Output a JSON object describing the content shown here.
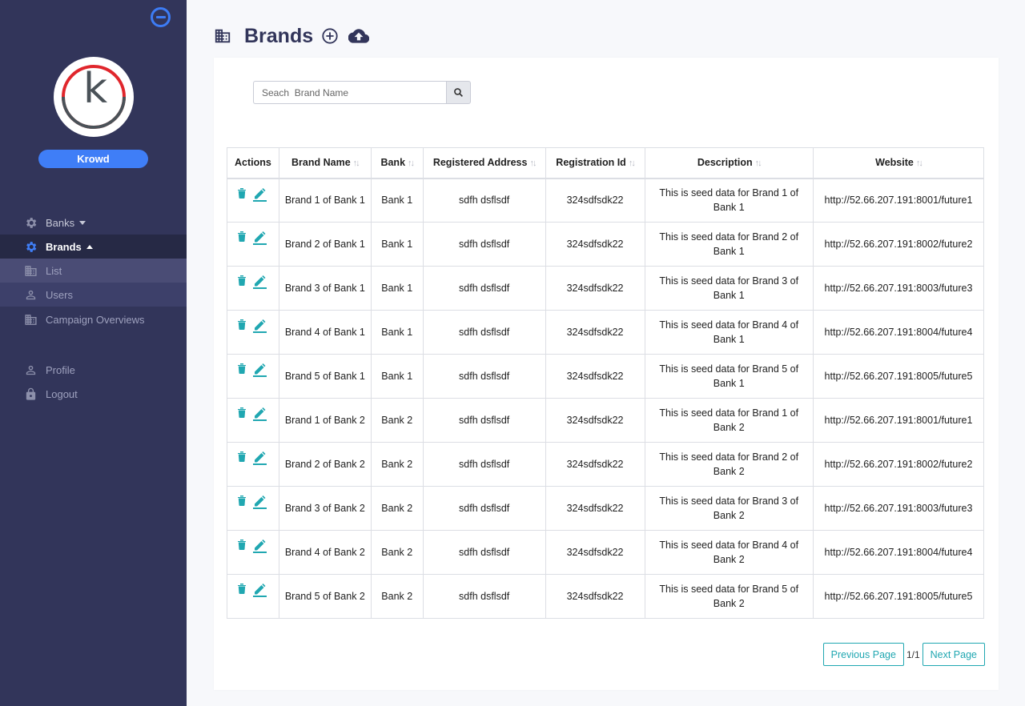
{
  "sidebar": {
    "user_name": "Krowd",
    "logo_letter": "k",
    "nav": [
      {
        "label": "Banks",
        "icon": "gear-icon"
      },
      {
        "label": "Brands",
        "icon": "gear-icon"
      },
      {
        "label": "List",
        "icon": "building-icon"
      },
      {
        "label": "Users",
        "icon": "user-icon"
      },
      {
        "label": "Campaign Overviews",
        "icon": "building-icon"
      },
      {
        "label": "Profile",
        "icon": "user-icon"
      },
      {
        "label": "Logout",
        "icon": "lock-icon"
      }
    ]
  },
  "header": {
    "title": "Brands"
  },
  "search": {
    "placeholder": "Seach  Brand Name"
  },
  "table": {
    "columns": [
      "Actions",
      "Brand Name",
      "Bank",
      "Registered Address",
      "Registration Id",
      "Description",
      "Website"
    ],
    "rows": [
      {
        "brand": "Brand 1 of Bank 1",
        "bank": "Bank 1",
        "address": "sdfh dsflsdf",
        "reg_id": "324sdfsdk22",
        "description": "This is seed data for Brand 1 of Bank 1",
        "website": "http://52.66.207.191:8001/future1"
      },
      {
        "brand": "Brand 2 of Bank 1",
        "bank": "Bank 1",
        "address": "sdfh dsflsdf",
        "reg_id": "324sdfsdk22",
        "description": "This is seed data for Brand 2 of Bank 1",
        "website": "http://52.66.207.191:8002/future2"
      },
      {
        "brand": "Brand 3 of Bank 1",
        "bank": "Bank 1",
        "address": "sdfh dsflsdf",
        "reg_id": "324sdfsdk22",
        "description": "This is seed data for Brand 3 of Bank 1",
        "website": "http://52.66.207.191:8003/future3"
      },
      {
        "brand": "Brand 4 of Bank 1",
        "bank": "Bank 1",
        "address": "sdfh dsflsdf",
        "reg_id": "324sdfsdk22",
        "description": "This is seed data for Brand 4 of Bank 1",
        "website": "http://52.66.207.191:8004/future4"
      },
      {
        "brand": "Brand 5 of Bank 1",
        "bank": "Bank 1",
        "address": "sdfh dsflsdf",
        "reg_id": "324sdfsdk22",
        "description": "This is seed data for Brand 5 of Bank 1",
        "website": "http://52.66.207.191:8005/future5"
      },
      {
        "brand": "Brand 1 of Bank 2",
        "bank": "Bank 2",
        "address": "sdfh dsflsdf",
        "reg_id": "324sdfsdk22",
        "description": "This is seed data for Brand 1 of Bank 2",
        "website": "http://52.66.207.191:8001/future1"
      },
      {
        "brand": "Brand 2 of Bank 2",
        "bank": "Bank 2",
        "address": "sdfh dsflsdf",
        "reg_id": "324sdfsdk22",
        "description": "This is seed data for Brand 2 of Bank 2",
        "website": "http://52.66.207.191:8002/future2"
      },
      {
        "brand": "Brand 3 of Bank 2",
        "bank": "Bank 2",
        "address": "sdfh dsflsdf",
        "reg_id": "324sdfsdk22",
        "description": "This is seed data for Brand 3 of Bank 2",
        "website": "http://52.66.207.191:8003/future3"
      },
      {
        "brand": "Brand 4 of Bank 2",
        "bank": "Bank 2",
        "address": "sdfh dsflsdf",
        "reg_id": "324sdfsdk22",
        "description": "This is seed data for Brand 4 of Bank 2",
        "website": "http://52.66.207.191:8004/future4"
      },
      {
        "brand": "Brand 5 of Bank 2",
        "bank": "Bank 2",
        "address": "sdfh dsflsdf",
        "reg_id": "324sdfsdk22",
        "description": "This is seed data for Brand 5 of Bank 2",
        "website": "http://52.66.207.191:8005/future5"
      }
    ]
  },
  "pager": {
    "prev_label": "Previous Page",
    "page_info": "1/1",
    "next_label": "Next Page"
  },
  "colors": {
    "sidebar_bg": "#32355a",
    "accent": "#3f7ef7",
    "action_teal": "#20a7b1"
  }
}
